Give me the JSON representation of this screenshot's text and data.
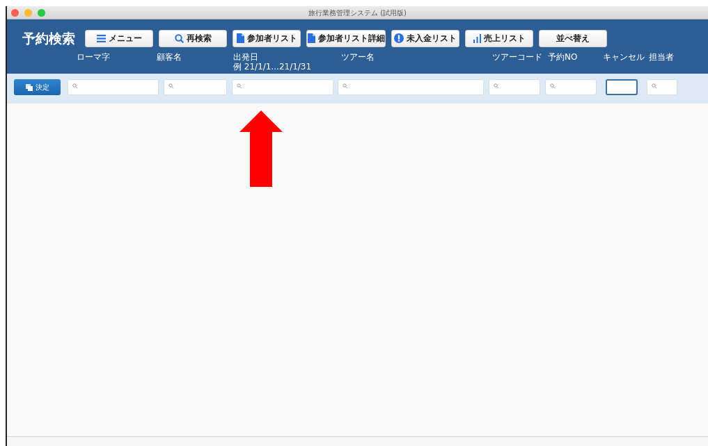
{
  "window": {
    "title": "旅行業務管理システム (試用版)"
  },
  "header": {
    "title": "予約検索",
    "buttons": [
      {
        "label": "メニュー",
        "kind": "menu"
      },
      {
        "label": "再検索",
        "kind": "search"
      },
      {
        "label": "参加者リスト",
        "kind": "document"
      },
      {
        "label": "参加者リスト詳細",
        "kind": "document"
      },
      {
        "label": "未入金リスト",
        "kind": "alert"
      },
      {
        "label": "売上リスト",
        "kind": "bars"
      },
      {
        "label": "並べ替え",
        "kind": "plain"
      }
    ]
  },
  "filters": {
    "confirm_button": "決定",
    "columns": [
      {
        "label": "ローマ字",
        "focused": false,
        "search_icon": true
      },
      {
        "label": "顧客名",
        "focused": false,
        "search_icon": true
      },
      {
        "label": "出発日",
        "hint": "例 21/1/1...21/1/31",
        "focused": false,
        "search_icon": true
      },
      {
        "label": "ツアー名",
        "focused": false,
        "search_icon": true
      },
      {
        "label": "ツアーコード",
        "focused": false,
        "search_icon": true
      },
      {
        "label": "予約NO",
        "focused": false,
        "search_icon": true
      },
      {
        "label": "キャンセル",
        "focused": true,
        "search_icon": false
      },
      {
        "label": "担当者",
        "focused": false,
        "search_icon": true
      }
    ]
  }
}
